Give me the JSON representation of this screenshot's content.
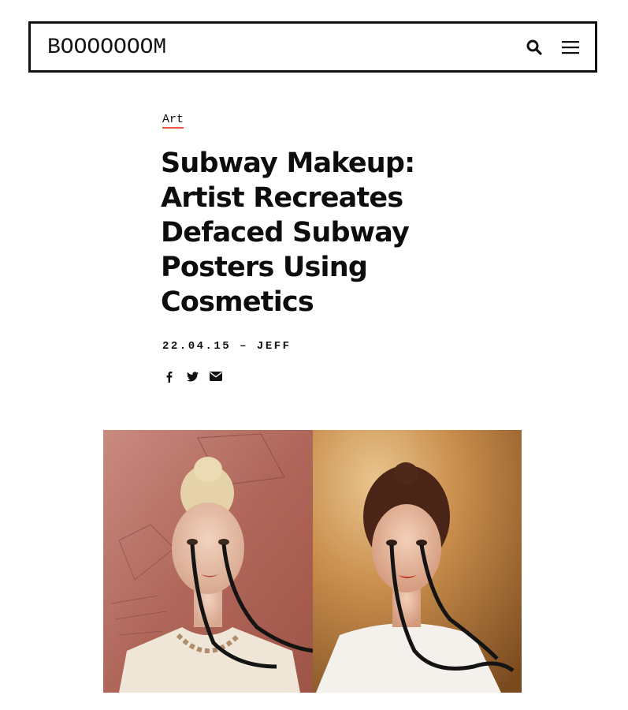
{
  "header": {
    "logo": "BOOOOOOOM",
    "search_icon": "search-icon",
    "menu_icon": "hamburger-menu-icon"
  },
  "article": {
    "category": "Art",
    "title": "Subway Makeup: Artist Recreates Defaced Subway Posters Using Cosmetics",
    "meta": "22.04.15 – JEFF",
    "share_icons": [
      "facebook-icon",
      "twitter-icon",
      "email-icon"
    ]
  },
  "colors": {
    "accent": "#e8553d",
    "text": "#111111",
    "background": "#ffffff"
  }
}
